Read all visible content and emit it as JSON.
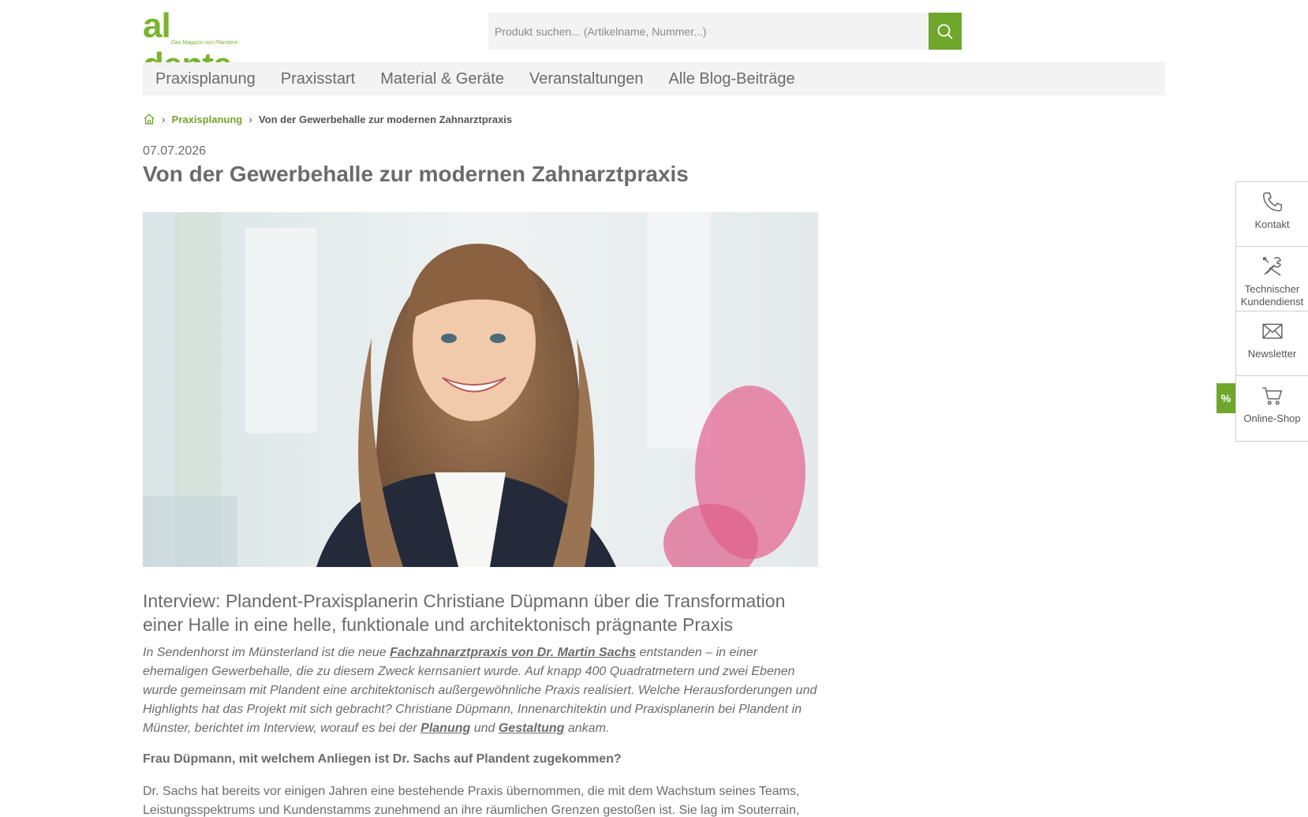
{
  "logo": {
    "main": "al dente",
    "sub": "Das Magazin von Plandent"
  },
  "search": {
    "placeholder": "Produkt suchen... (Artikelname, Nummer...)"
  },
  "nav": {
    "items": [
      "Praxisplanung",
      "Praxisstart",
      "Material & Geräte",
      "Veranstaltungen",
      "Alle Blog-Beiträge"
    ]
  },
  "breadcrumb": {
    "sep": "›",
    "category": "Praxisplanung",
    "current": "Von der Gewerbehalle zur modernen Zahnarztpraxis"
  },
  "article": {
    "date": "07.07.2026",
    "title": "Von der Gewerbehalle zur modernen Zahnarztpraxis",
    "subhead": "Interview: Plandent-Praxisplanerin Christiane Düpmann über die Transformation einer Halle in eine helle, funktionale und architektonisch prägnante Praxis",
    "intro_1": "In Sendenhorst im Münsterland ist die neue ",
    "intro_link_1": "Fachzahnarztpraxis von Dr. Martin Sachs",
    "intro_2": " entstanden – in einer ehemaligen Gewerbehalle, die zu diesem Zweck kernsaniert wurde. Auf knapp 400 Quadratmetern und zwei Ebenen wurde gemeinsam mit Plandent eine architektonisch außergewöhnliche Praxis realisiert. Welche Herausforderungen und Highlights hat das Projekt mit sich gebracht? Christiane Düpmann, Innenarchitektin und Praxisplanerin bei Plandent in Münster, berichtet im Interview, worauf es bei der ",
    "intro_link_2": "Planung",
    "intro_3": " und ",
    "intro_link_3": "Gestaltung",
    "intro_4": " ankam.",
    "question": "Frau Düpmann, mit welchem Anliegen ist Dr. Sachs auf Plandent zugekommen?",
    "answer": "Dr. Sachs hat bereits vor einigen Jahren eine bestehende Praxis übernommen, die mit dem Wachstum seines Teams, Leistungsspektrums und Kundenstamms zunehmend an ihre räumlichen Grenzen gestoßen ist. Sie lag im Souterrain, war"
  },
  "side": {
    "contact": "Kontakt",
    "service_1": "Technischer",
    "service_2": "Kundendienst",
    "newsletter": "Newsletter",
    "shop": "Online-Shop",
    "percent": "%"
  },
  "colors": {
    "accent": "#6fa72c",
    "text": "#6b6b6b",
    "nav_bg": "#f3f3f3"
  }
}
